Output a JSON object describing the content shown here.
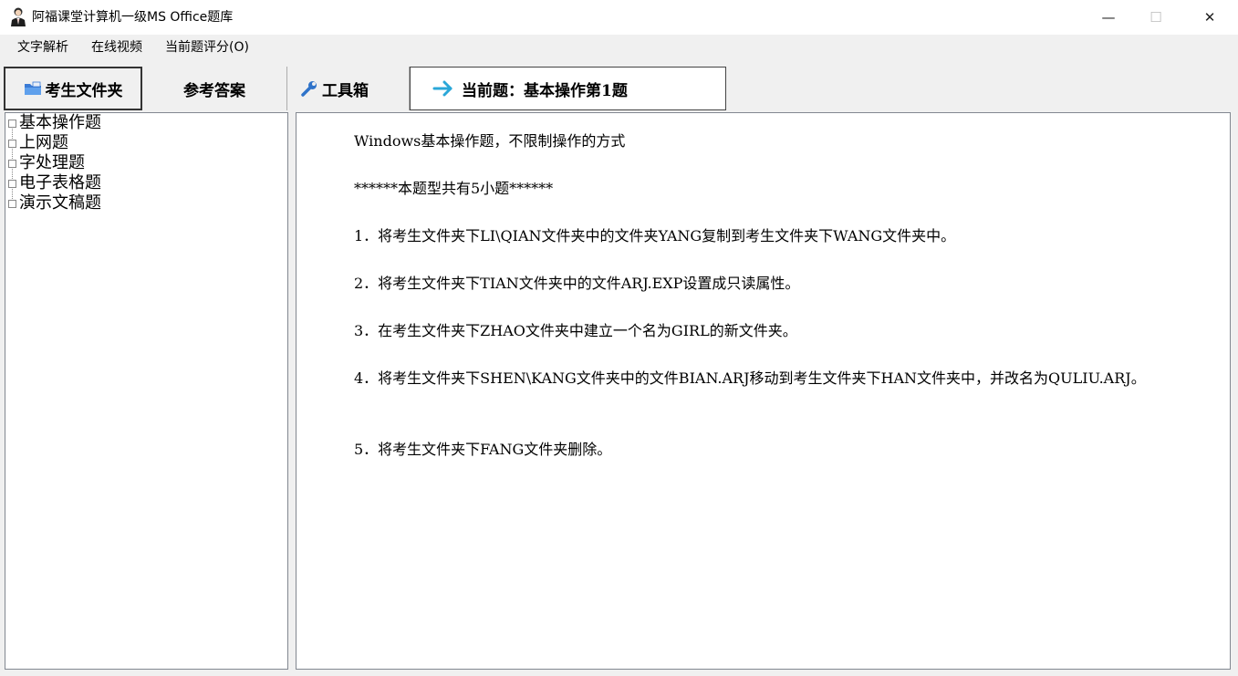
{
  "window": {
    "title": "阿福课堂计算机一级MS Office题库",
    "minimize_glyph": "—",
    "maximize_glyph": "☐",
    "close_glyph": "✕"
  },
  "menu": [
    "文字解析",
    "在线视频",
    "当前题评分(O)"
  ],
  "tabs": {
    "folder": "考生文件夹",
    "answer": "参考答案",
    "tools": "工具箱",
    "current": "当前题：基本操作第1题",
    "folder_icon": "folder-icon",
    "tools_icon": "wrench-icon",
    "current_icon": "arrow-right-icon"
  },
  "tree": {
    "items": [
      "基本操作题",
      "上网题",
      "字处理题",
      "电子表格题",
      "演示文稿题"
    ]
  },
  "content": {
    "paragraphs": [
      "Windows基本操作题，不限制操作的方式",
      "******本题型共有5小题******",
      "1．将考生文件夹下LI\\QIAN文件夹中的文件夹YANG复制到考生文件夹下WANG文件夹中。",
      "2．将考生文件夹下TIAN文件夹中的文件ARJ.EXP设置成只读属性。",
      "3．在考生文件夹下ZHAO文件夹中建立一个名为GIRL的新文件夹。",
      "4．将考生文件夹下SHEN\\KANG文件夹中的文件BIAN.ARJ移动到考生文件夹下HAN文件夹中，并改名为QULIU.ARJ。",
      "5．将考生文件夹下FANG文件夹删除。"
    ]
  },
  "colors": {
    "folder_icon": "#3a7bd5",
    "tools_icon": "#2f73c9",
    "arrow_icon": "#2aa7d8"
  }
}
